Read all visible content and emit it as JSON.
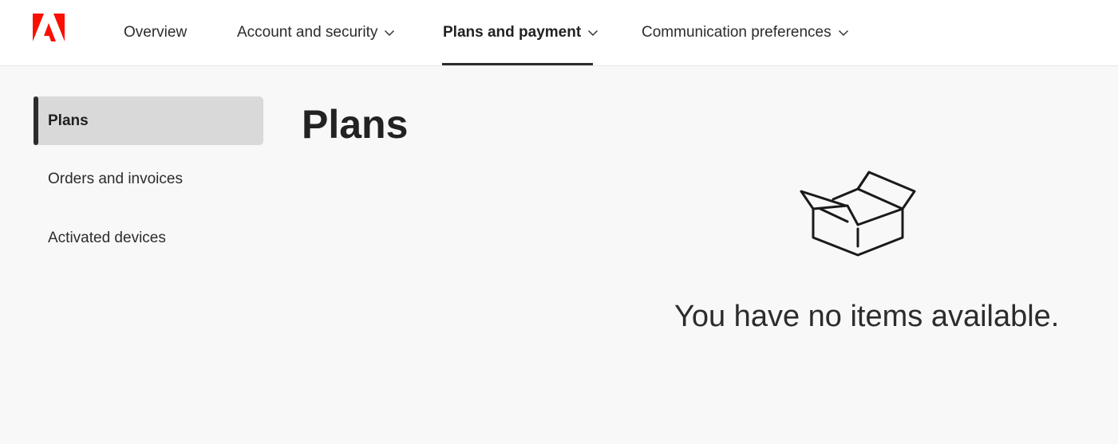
{
  "nav": {
    "items": [
      {
        "label": "Overview",
        "has_dropdown": false,
        "active": false
      },
      {
        "label": "Account and security",
        "has_dropdown": true,
        "active": false
      },
      {
        "label": "Plans and payment",
        "has_dropdown": true,
        "active": true
      },
      {
        "label": "Communication preferences",
        "has_dropdown": true,
        "active": false
      }
    ]
  },
  "brand": {
    "logo_icon": "adobe-logo-icon",
    "color": "#fa0f00"
  },
  "sidebar": {
    "items": [
      {
        "label": "Plans",
        "selected": true
      },
      {
        "label": "Orders and invoices",
        "selected": false
      },
      {
        "label": "Activated devices",
        "selected": false
      }
    ]
  },
  "main": {
    "title": "Plans",
    "empty_state": {
      "icon": "empty-box-icon",
      "message": "You have no items available."
    }
  }
}
